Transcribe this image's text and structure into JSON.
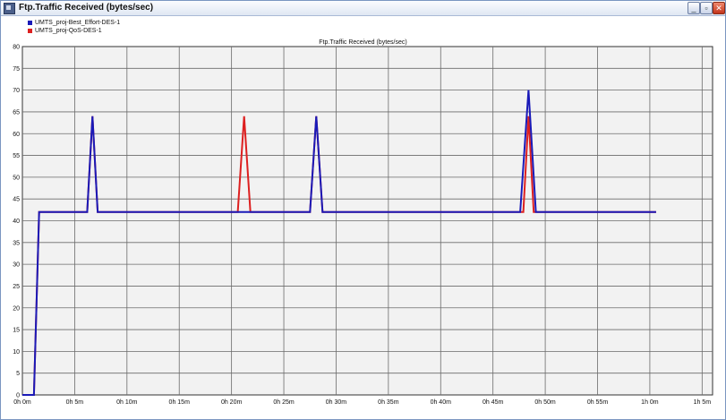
{
  "window": {
    "title": "Ftp.Traffic Received (bytes/sec)",
    "buttons": {
      "minimize": "_",
      "restore": "▫",
      "close": "✕"
    }
  },
  "chart_data": {
    "type": "line",
    "title": "Ftp.Traffic Received (bytes/sec)",
    "xlabel": "",
    "ylabel": "",
    "xlim": [
      0,
      66
    ],
    "ylim": [
      0,
      80
    ],
    "x_unit": "minutes",
    "grid": true,
    "legend_position": "top-left",
    "yticks": [
      0,
      5,
      10,
      15,
      20,
      25,
      30,
      35,
      40,
      45,
      50,
      55,
      60,
      65,
      70,
      75,
      80
    ],
    "xticks": [
      {
        "value": 0,
        "label": "0h 0m"
      },
      {
        "value": 5,
        "label": "0h 5m"
      },
      {
        "value": 10,
        "label": "0h 10m"
      },
      {
        "value": 15,
        "label": "0h 15m"
      },
      {
        "value": 20,
        "label": "0h 20m"
      },
      {
        "value": 25,
        "label": "0h 25m"
      },
      {
        "value": 30,
        "label": "0h 30m"
      },
      {
        "value": 35,
        "label": "0h 35m"
      },
      {
        "value": 40,
        "label": "0h 40m"
      },
      {
        "value": 45,
        "label": "0h 45m"
      },
      {
        "value": 50,
        "label": "0h 50m"
      },
      {
        "value": 55,
        "label": "0h 55m"
      },
      {
        "value": 60,
        "label": "1h 0m"
      },
      {
        "value": 65,
        "label": "1h 5m"
      }
    ],
    "series": [
      {
        "name": "UMTS_proj-QoS-DES-1",
        "color": "#dd2020",
        "points": [
          [
            0,
            0
          ],
          [
            1.1,
            0
          ],
          [
            1.6,
            42
          ],
          [
            6.2,
            42
          ],
          [
            6.7,
            64
          ],
          [
            7.2,
            42
          ],
          [
            20.6,
            42
          ],
          [
            21.2,
            64
          ],
          [
            21.8,
            42
          ],
          [
            27.5,
            42
          ],
          [
            28.1,
            64
          ],
          [
            28.7,
            42
          ],
          [
            47.9,
            42
          ],
          [
            48.4,
            64
          ],
          [
            48.9,
            42
          ],
          [
            60.6,
            42
          ]
        ]
      },
      {
        "name": "UMTS_proj-Best_Effort-DES-1",
        "color": "#1a1ab8",
        "points": [
          [
            0,
            0
          ],
          [
            1.1,
            0
          ],
          [
            1.6,
            42
          ],
          [
            6.2,
            42
          ],
          [
            6.7,
            64
          ],
          [
            7.2,
            42
          ],
          [
            27.5,
            42
          ],
          [
            28.1,
            64
          ],
          [
            28.7,
            42
          ],
          [
            47.6,
            42
          ],
          [
            48.4,
            70
          ],
          [
            49.1,
            42
          ],
          [
            60.6,
            42
          ]
        ]
      }
    ],
    "legend": [
      {
        "label": "UMTS_proj-Best_Effort-DES-1",
        "color": "#1a1ab8"
      },
      {
        "label": "UMTS_proj-QoS-DES-1",
        "color": "#dd2020"
      }
    ]
  }
}
